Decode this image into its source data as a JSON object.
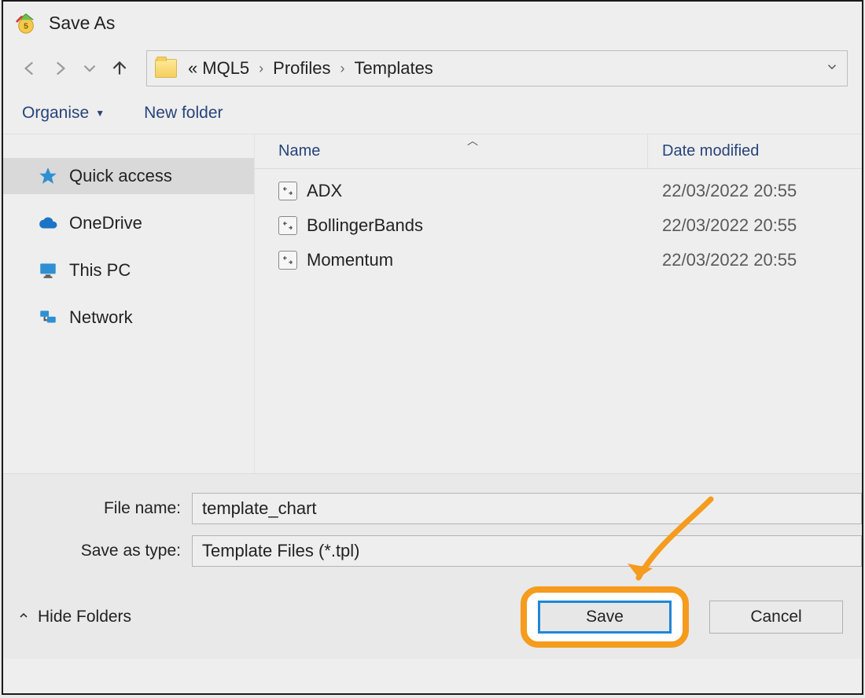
{
  "title": "Save As",
  "breadcrumb": {
    "prefix": "«",
    "items": [
      "MQL5",
      "Profiles",
      "Templates"
    ]
  },
  "toolbar": {
    "organise": "Organise",
    "new_folder": "New folder"
  },
  "sidebar": {
    "items": [
      {
        "label": "Quick access",
        "icon": "star",
        "selected": true
      },
      {
        "label": "OneDrive",
        "icon": "cloud",
        "selected": false
      },
      {
        "label": "This PC",
        "icon": "monitor",
        "selected": false
      },
      {
        "label": "Network",
        "icon": "network",
        "selected": false
      }
    ]
  },
  "columns": {
    "name": "Name",
    "date": "Date modified"
  },
  "files": [
    {
      "name": "ADX",
      "date": "22/03/2022 20:55"
    },
    {
      "name": "BollingerBands",
      "date": "22/03/2022 20:55"
    },
    {
      "name": "Momentum",
      "date": "22/03/2022 20:55"
    }
  ],
  "form": {
    "file_name_label": "File name:",
    "file_name_value": "template_chart",
    "save_type_label": "Save as type:",
    "save_type_value": "Template Files (*.tpl)"
  },
  "footer": {
    "hide_folders": "Hide Folders",
    "save": "Save",
    "cancel": "Cancel"
  }
}
